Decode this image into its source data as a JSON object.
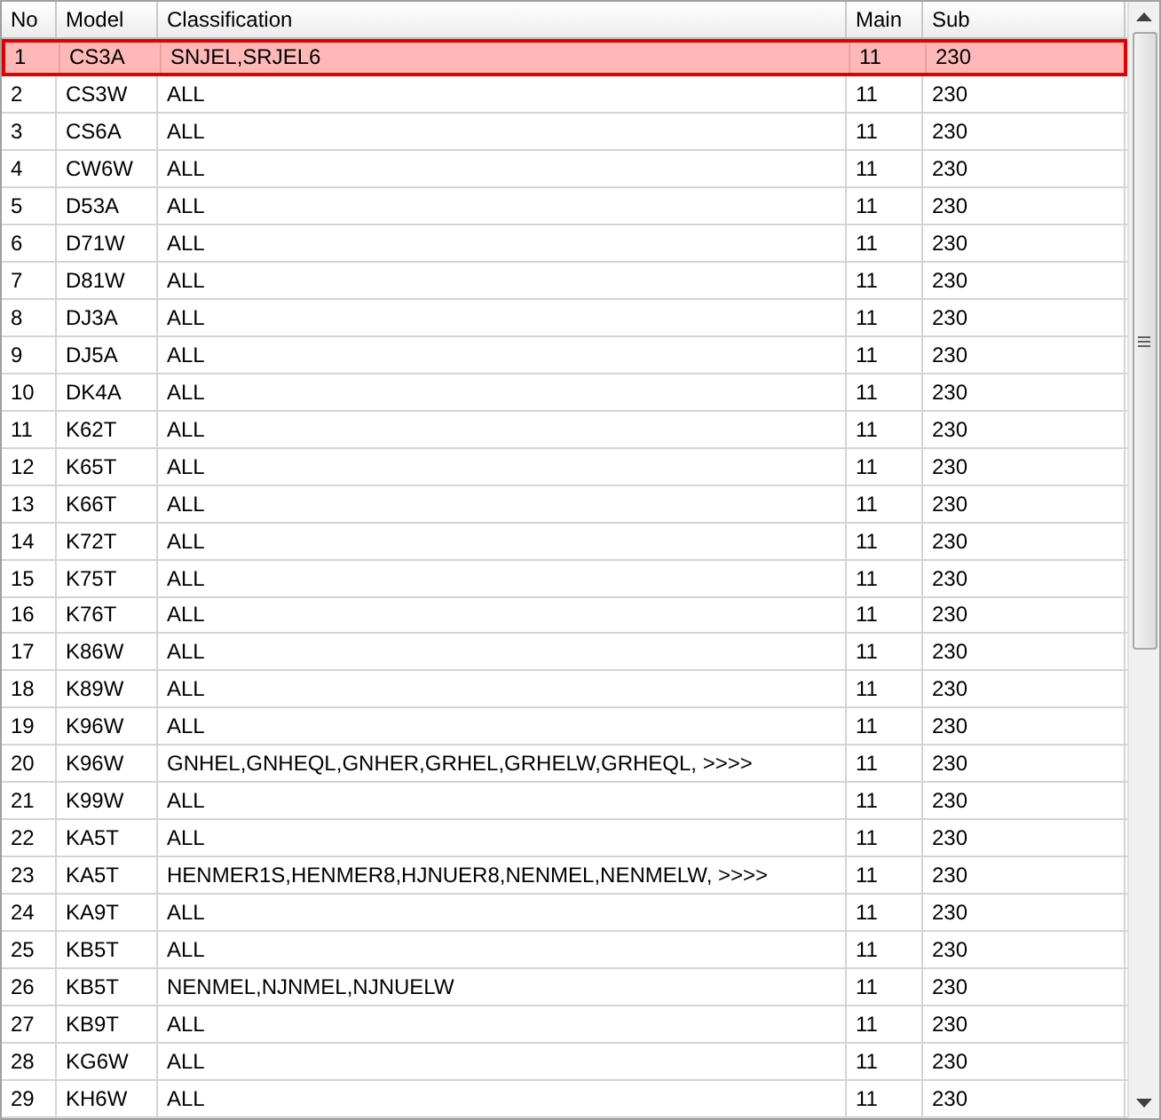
{
  "table": {
    "columns": [
      "No",
      "Model",
      "Classification",
      "Main",
      "Sub"
    ],
    "rows": [
      {
        "cells": [
          "1",
          "CS3A",
          "SNJEL,SRJEL6",
          "11",
          "230"
        ],
        "selected": true
      },
      {
        "cells": [
          "2",
          "CS3W",
          "ALL",
          "11",
          "230"
        ],
        "selected": false
      },
      {
        "cells": [
          "3",
          "CS6A",
          "ALL",
          "11",
          "230"
        ],
        "selected": false
      },
      {
        "cells": [
          "4",
          "CW6W",
          "ALL",
          "11",
          "230"
        ],
        "selected": false
      },
      {
        "cells": [
          "5",
          "D53A",
          "ALL",
          "11",
          "230"
        ],
        "selected": false
      },
      {
        "cells": [
          "6",
          "D71W",
          "ALL",
          "11",
          "230"
        ],
        "selected": false
      },
      {
        "cells": [
          "7",
          "D81W",
          "ALL",
          "11",
          "230"
        ],
        "selected": false
      },
      {
        "cells": [
          "8",
          "DJ3A",
          "ALL",
          "11",
          "230"
        ],
        "selected": false
      },
      {
        "cells": [
          "9",
          "DJ5A",
          "ALL",
          "11",
          "230"
        ],
        "selected": false
      },
      {
        "cells": [
          "10",
          "DK4A",
          "ALL",
          "11",
          "230"
        ],
        "selected": false
      },
      {
        "cells": [
          "11",
          "K62T",
          "ALL",
          "11",
          "230"
        ],
        "selected": false
      },
      {
        "cells": [
          "12",
          "K65T",
          "ALL",
          "11",
          "230"
        ],
        "selected": false
      },
      {
        "cells": [
          "13",
          "K66T",
          "ALL",
          "11",
          "230"
        ],
        "selected": false
      },
      {
        "cells": [
          "14",
          "K72T",
          "ALL",
          "11",
          "230"
        ],
        "selected": false
      },
      {
        "cells": [
          "15",
          "K75T",
          "ALL",
          "11",
          "230"
        ],
        "selected": false
      },
      {
        "cells": [
          "16",
          "K76T",
          "ALL",
          "11",
          "230"
        ],
        "selected": false
      },
      {
        "cells": [
          "17",
          "K86W",
          "ALL",
          "11",
          "230"
        ],
        "selected": false
      },
      {
        "cells": [
          "18",
          "K89W",
          "ALL",
          "11",
          "230"
        ],
        "selected": false
      },
      {
        "cells": [
          "19",
          "K96W",
          "ALL",
          "11",
          "230"
        ],
        "selected": false
      },
      {
        "cells": [
          "20",
          "K96W",
          "GNHEL,GNHEQL,GNHER,GRHEL,GRHELW,GRHEQL,  >>>>",
          "11",
          "230"
        ],
        "selected": false
      },
      {
        "cells": [
          "21",
          "K99W",
          "ALL",
          "11",
          "230"
        ],
        "selected": false
      },
      {
        "cells": [
          "22",
          "KA5T",
          "ALL",
          "11",
          "230"
        ],
        "selected": false
      },
      {
        "cells": [
          "23",
          "KA5T",
          "HENMER1S,HENMER8,HJNUER8,NENMEL,NENMELW,  >>>>",
          "11",
          "230"
        ],
        "selected": false
      },
      {
        "cells": [
          "24",
          "KA9T",
          "ALL",
          "11",
          "230"
        ],
        "selected": false
      },
      {
        "cells": [
          "25",
          "KB5T",
          "ALL",
          "11",
          "230"
        ],
        "selected": false
      },
      {
        "cells": [
          "26",
          "KB5T",
          "NENMEL,NJNMEL,NJNUELW",
          "11",
          "230"
        ],
        "selected": false
      },
      {
        "cells": [
          "27",
          "KB9T",
          "ALL",
          "11",
          "230"
        ],
        "selected": false
      },
      {
        "cells": [
          "28",
          "KG6W",
          "ALL",
          "11",
          "230"
        ],
        "selected": false
      },
      {
        "cells": [
          "29",
          "KH6W",
          "ALL",
          "11",
          "230"
        ],
        "selected": false
      }
    ]
  }
}
